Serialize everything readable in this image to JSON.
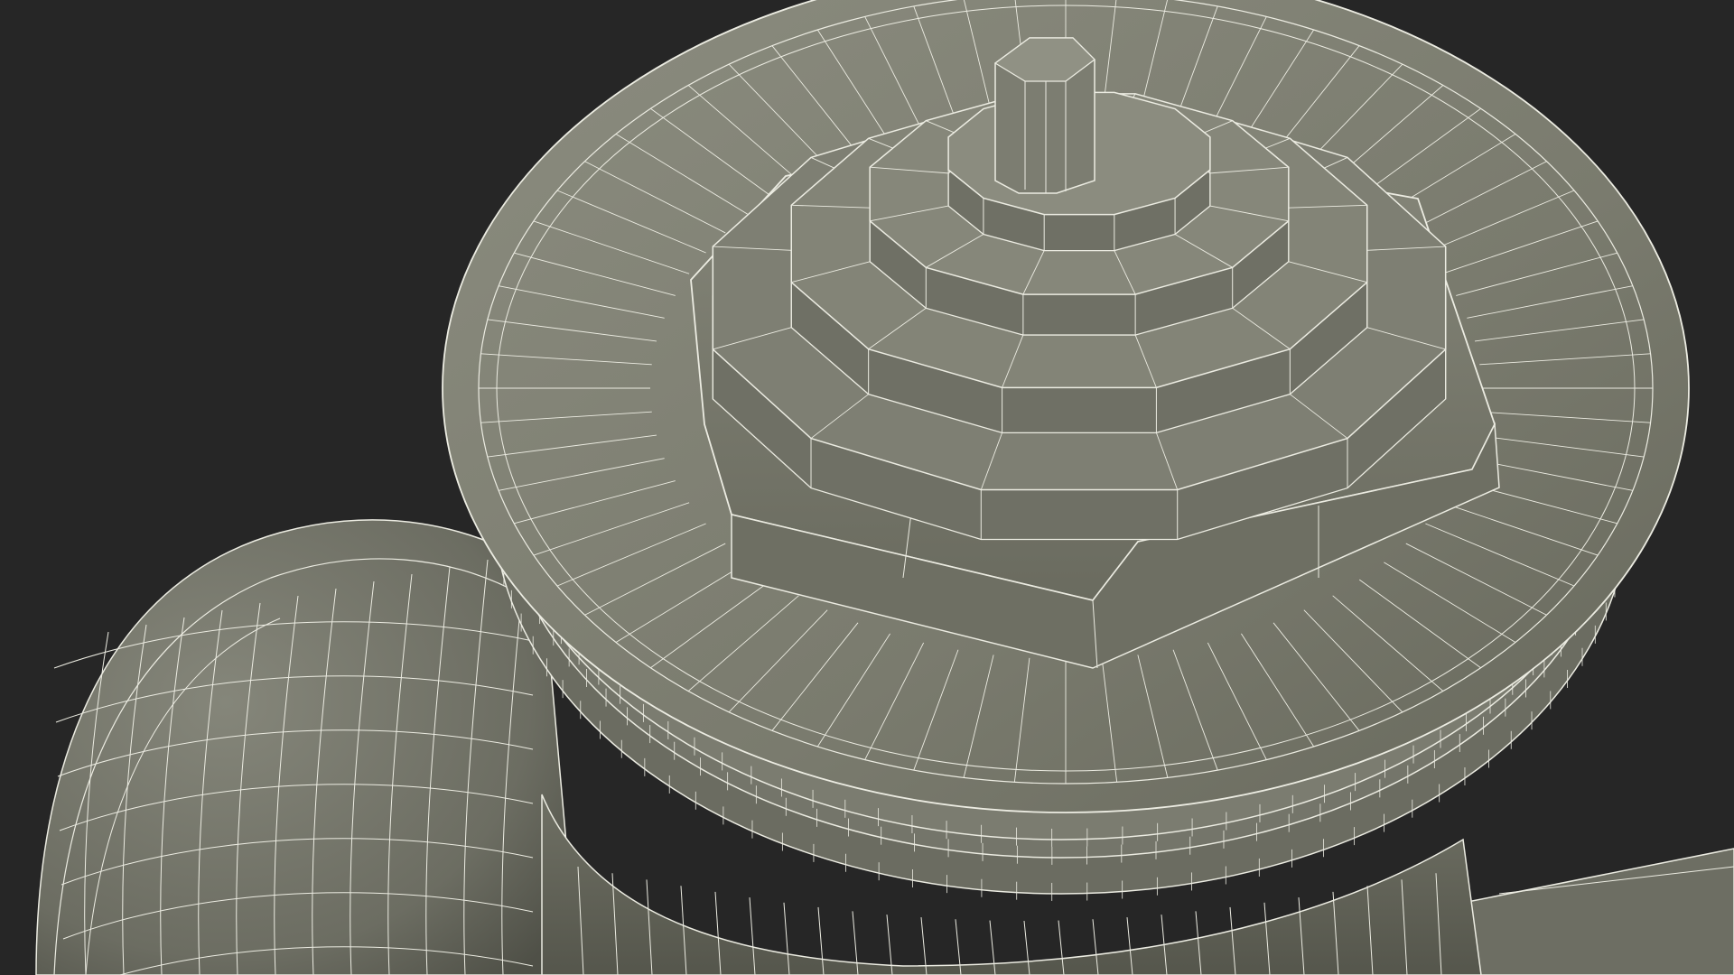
{
  "scene": {
    "subject": "wireframe-3d-model",
    "colors": {
      "background": "#262626",
      "surface_light": "#8a8b7d",
      "surface_mid": "#76776a",
      "surface_dark": "#5c5d52",
      "surface_shadow": "#4a4b42",
      "wire": "#ecece2"
    }
  }
}
